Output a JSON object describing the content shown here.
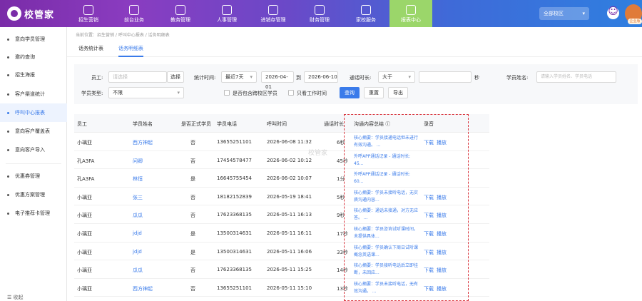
{
  "app": {
    "logo": "校管家"
  },
  "nav": {
    "items": [
      {
        "label": "招生营销",
        "icon": "people-plus-icon"
      },
      {
        "label": "前台业务",
        "icon": "calendar-icon"
      },
      {
        "label": "教务管理",
        "icon": "document-icon"
      },
      {
        "label": "人事管理",
        "icon": "person-icon"
      },
      {
        "label": "进销存管理",
        "icon": "box-icon"
      },
      {
        "label": "财务管理",
        "icon": "house-icon"
      },
      {
        "label": "家校服务",
        "icon": "chat-icon"
      },
      {
        "label": "报表中心",
        "icon": "report-icon"
      }
    ],
    "active_index": 7,
    "campus_select": "全部校区",
    "avatar_badge": "企业版"
  },
  "sidebar": {
    "items": [
      {
        "label": "意向学员管理"
      },
      {
        "label": "邀约查询"
      },
      {
        "label": "招生海报"
      },
      {
        "label": "客户渠道统计"
      },
      {
        "label": "呼叫中心报表"
      },
      {
        "label": "意向客户覆盖表"
      },
      {
        "label": "意向客户导入"
      },
      {
        "label": "优惠券管理"
      },
      {
        "label": "优惠方案管理"
      },
      {
        "label": "电子推荐卡管理"
      }
    ],
    "active_index": 4,
    "collapse_label": "收起"
  },
  "breadcrumb": "当前位置：招生营销 / 呼叫中心报表 / 话务明细表",
  "tabs": [
    {
      "label": "话务统计表"
    },
    {
      "label": "话务明细表"
    }
  ],
  "filters": {
    "employee_label": "员工:",
    "employee_placeholder": "请选择",
    "select_button": "选择",
    "time_label": "统计时间:",
    "time_range_select": "最近7天",
    "date_start": "2026-04-01",
    "date_to": "到",
    "date_end": "2026-06-10",
    "duration_label": "通话时长:",
    "duration_op": "大于",
    "duration_unit": "秒",
    "student_name_label": "学员姓名:",
    "student_name_placeholder": "请输入学员姓名、学员电话",
    "student_type_label": "学员类型:",
    "student_type_value": "不限",
    "include_cross_campus": "是否包含跨校区学员",
    "work_time_only": "只看工作时间",
    "query_button": "查询",
    "reset_button": "重置",
    "export_button": "导出"
  },
  "table": {
    "headers": [
      "员工",
      "学员姓名",
      "是否正式学员",
      "学员电话",
      "呼叫时间",
      "通话时长",
      "沟通内容总结 ⓘ",
      "录音"
    ],
    "rows": [
      {
        "employee": "小璃亚",
        "student": "西方神起",
        "formal": "否",
        "phone": "13655251101",
        "time": "2026-06-08 11:32",
        "duration": "6秒",
        "summary": "核心摘要：学员接通电话但未进行有效沟通。 ...",
        "download": "下载",
        "play": "播放"
      },
      {
        "employee": "孔A3FA",
        "student": "问卿",
        "formal": "否",
        "phone": "17454578477",
        "time": "2026-06-02 10:12",
        "duration": "45秒",
        "summary": "外呼APP通话记录 - 通话时长: 45...",
        "download": "",
        "play": ""
      },
      {
        "employee": "孔A3FA",
        "student": "林恒",
        "formal": "是",
        "phone": "16645755454",
        "time": "2026-06-02 10:07",
        "duration": "1分",
        "summary": "外呼APP通话记录 - 通话时长: 60...",
        "download": "",
        "play": ""
      },
      {
        "employee": "小璃亚",
        "student": "张三",
        "formal": "否",
        "phone": "18182152839",
        "time": "2026-05-19 18:41",
        "duration": "5秒",
        "summary": "核心摘要：学员未接听电话，无实质沟通内容...",
        "download": "下载",
        "play": "播放"
      },
      {
        "employee": "小璃亚",
        "student": "瓜瓜",
        "formal": "否",
        "phone": "17623368135",
        "time": "2026-05-11 16:13",
        "duration": "9秒",
        "summary": "核心摘要：通话未接通，对方无应答。 ...",
        "download": "下载",
        "play": "播放"
      },
      {
        "employee": "小璃亚",
        "student": "jdjd",
        "formal": "是",
        "phone": "13500314631",
        "time": "2026-05-11 16:11",
        "duration": "17秒",
        "summary": "核心摘要：学员咨询试听课时间，未提供具体...",
        "download": "下载",
        "play": "播放"
      },
      {
        "employee": "小璃亚",
        "student": "jdjd",
        "formal": "是",
        "phone": "13500314631",
        "time": "2026-05-11 16:06",
        "duration": "33秒",
        "summary": "核心摘要：学员确认下周日试听课概念英语课...",
        "download": "下载",
        "play": "播放"
      },
      {
        "employee": "小璃亚",
        "student": "瓜瓜",
        "formal": "否",
        "phone": "17623368135",
        "time": "2026-05-11 15:25",
        "duration": "14秒",
        "summary": "核心摘要：学员接听电话后立即挂断，未回应...",
        "download": "下载",
        "play": "播放"
      },
      {
        "employee": "小璃亚",
        "student": "西方神起",
        "formal": "否",
        "phone": "13655251101",
        "time": "2026-05-11 15:10",
        "duration": "13秒",
        "summary": "核心摘要：学员未接听电话，无有效沟通。 ...",
        "download": "下载",
        "play": "播放"
      }
    ]
  },
  "watermark": "校管家",
  "colors": {
    "accent": "#3a7bea",
    "highlight_border": "#d9363e",
    "nav_active": "#9bd66a"
  }
}
